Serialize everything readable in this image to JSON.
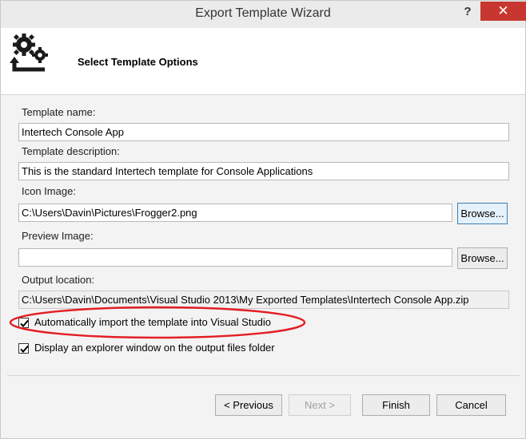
{
  "window": {
    "title": "Export Template Wizard",
    "help_symbol": "?",
    "close_symbol": "✕"
  },
  "header": {
    "title": "Select Template Options",
    "icon": "gears-export-icon"
  },
  "fields": {
    "template_name_label": "Template name:",
    "template_name_value": "Intertech Console App",
    "template_description_label": "Template description:",
    "template_description_value": "This is the standard Intertech template for Console Applications",
    "icon_image_label": "Icon Image:",
    "icon_image_value": "C:\\Users\\Davin\\Pictures\\Frogger2.png",
    "preview_image_label": "Preview Image:",
    "preview_image_value": "",
    "output_location_label": "Output location:",
    "output_location_value": "C:\\Users\\Davin\\Documents\\Visual Studio 2013\\My Exported Templates\\Intertech Console App.zip"
  },
  "browse_label": "Browse...",
  "options": {
    "auto_import_label": "Automatically import the template into Visual Studio",
    "auto_import_checked": true,
    "explorer_label": "Display an explorer window on the output files folder",
    "explorer_checked": true
  },
  "buttons": {
    "previous": "< Previous",
    "next": "Next >",
    "finish": "Finish",
    "cancel": "Cancel"
  },
  "colors": {
    "close_button": "#c7372f",
    "annotation_ellipse": "#e31e24",
    "focus_border": "#3c7fb1"
  }
}
